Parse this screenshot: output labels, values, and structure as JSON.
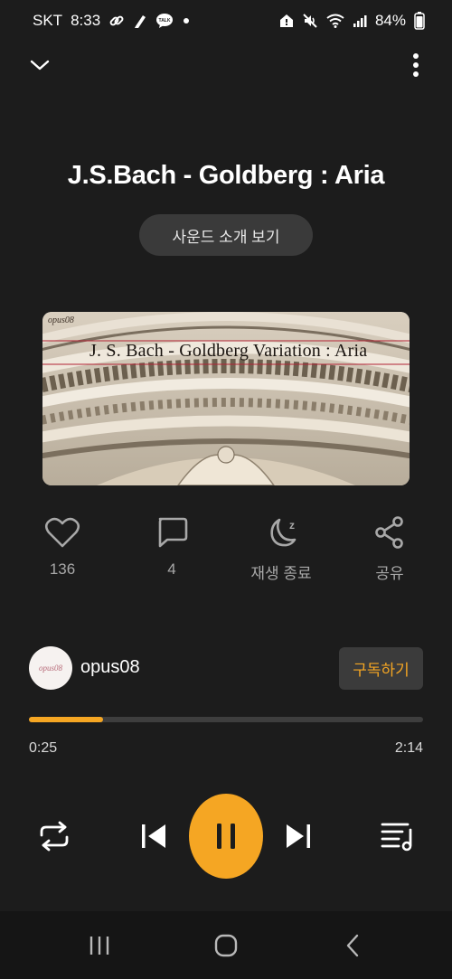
{
  "status_bar": {
    "carrier": "SKT",
    "time": "8:33",
    "talk_badge": "TALK",
    "battery": "84%",
    "icons": [
      "link-icon",
      "pen-icon",
      "kakaotalk-icon",
      "dot-icon",
      "home-alert-icon",
      "mute-icon",
      "wifi-icon",
      "signal-icon",
      "battery-icon"
    ]
  },
  "track": {
    "title": "J.S.Bach - Goldberg : Aria",
    "intro_button": "사운드 소개 보기"
  },
  "album_art": {
    "caption": "J. S. Bach - Goldberg Variation : Aria",
    "tag": "opus08"
  },
  "actions": {
    "like_count": "136",
    "comment_count": "4",
    "sleep_label": "재생 종료",
    "share_label": "공유"
  },
  "channel": {
    "avatar_text": "opus08",
    "name": "opus08",
    "subscribe_label": "구독하기"
  },
  "progress": {
    "current": "0:25",
    "total": "2:14",
    "fraction": 0.187
  },
  "colors": {
    "accent": "#f5a623",
    "background": "#1c1c1c",
    "button_bg": "#3a3a3a"
  }
}
